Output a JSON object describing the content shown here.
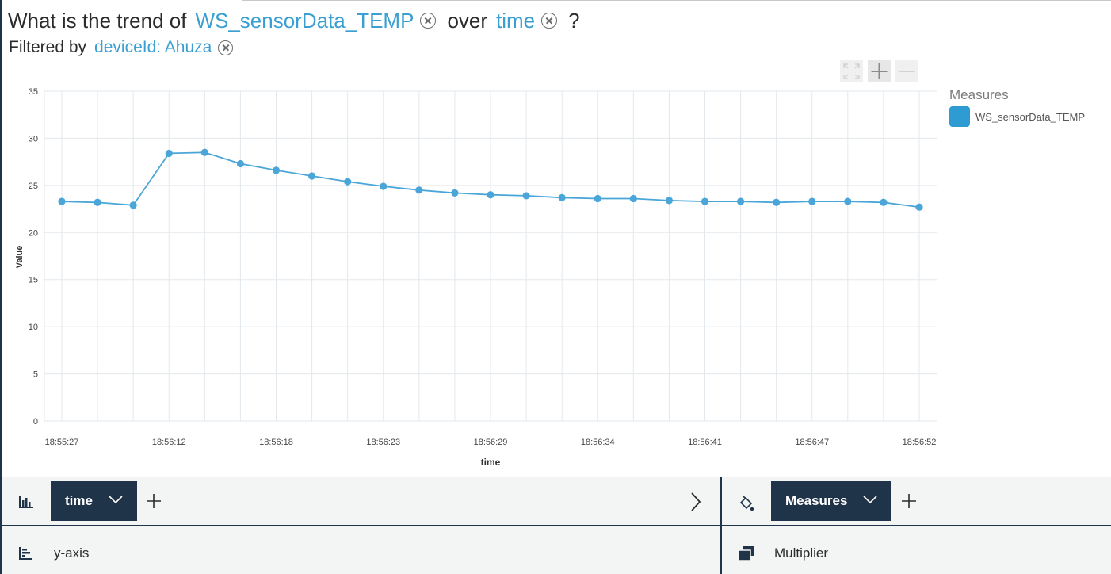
{
  "question": {
    "prefix": "What is the trend of",
    "measure": "WS_sensorData_TEMP",
    "over": "over",
    "dimension": "time",
    "suffix": "?"
  },
  "filter": {
    "label": "Filtered by",
    "value": "deviceId: Ahuza"
  },
  "legend": {
    "title": "Measures",
    "items": [
      "WS_sensorData_TEMP"
    ]
  },
  "colors": {
    "accent": "#3b9fd1",
    "series": "#4aa6d8",
    "navy": "#1f3349"
  },
  "icons": {
    "fit": "fit-to-screen-icon",
    "zoom_in": "plus-icon",
    "zoom_out": "minus-icon",
    "bar_chart": "bar-chart-icon",
    "paint": "paint-bucket-icon",
    "y_axis": "y-axis-icon",
    "multiplier": "stacked-windows-icon",
    "chevron": "chevron-down-icon",
    "next": "chevron-right-icon"
  },
  "shelves": {
    "x_pill": "time",
    "color_pill": "Measures",
    "y_axis_label": "y-axis",
    "multiplier_label": "Multiplier"
  },
  "chart_data": {
    "type": "line",
    "xlabel": "time",
    "ylabel": "Value",
    "ylim": [
      0,
      35
    ],
    "yticks": [
      0,
      5,
      10,
      15,
      20,
      25,
      30,
      35
    ],
    "x_tick_labels": [
      "18:55:27",
      "18:56:12",
      "18:56:18",
      "18:56:23",
      "18:56:29",
      "18:56:34",
      "18:56:41",
      "18:56:47",
      "18:56:52"
    ],
    "x_tick_every": 3,
    "grid": true,
    "legend_position": "top-right",
    "series": [
      {
        "name": "WS_sensorData_TEMP",
        "values": [
          23.3,
          23.2,
          22.9,
          28.4,
          28.5,
          27.3,
          26.6,
          26.0,
          25.4,
          24.9,
          24.5,
          24.2,
          24.0,
          23.9,
          23.7,
          23.6,
          23.6,
          23.4,
          23.3,
          23.3,
          23.2,
          23.3,
          23.3,
          23.2,
          22.7
        ]
      }
    ]
  }
}
